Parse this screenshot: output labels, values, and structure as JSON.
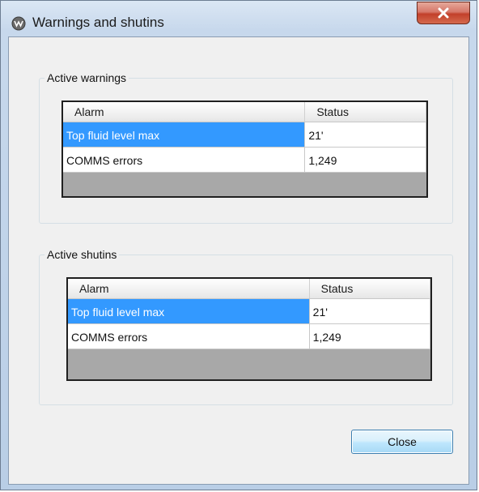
{
  "window": {
    "title": "Warnings and shutins",
    "app_icon": "app-logo-icon",
    "close_glyph": "✕"
  },
  "warnings": {
    "label": "Active warnings",
    "columns": [
      "Alarm",
      "Status"
    ],
    "rows": [
      {
        "alarm": "Top fluid level max",
        "status": "21'",
        "selected": true
      },
      {
        "alarm": "COMMS errors",
        "status": "1,249",
        "selected": false
      }
    ]
  },
  "shutins": {
    "label": "Active shutins",
    "columns": [
      "Alarm",
      "Status"
    ],
    "rows": [
      {
        "alarm": "Top fluid level max",
        "status": "21'",
        "selected": true
      },
      {
        "alarm": "COMMS errors",
        "status": "1,249",
        "selected": false
      }
    ]
  },
  "buttons": {
    "close_label": "Close"
  },
  "colors": {
    "selection": "#3399ff",
    "close_button_red": "#c2402a"
  }
}
